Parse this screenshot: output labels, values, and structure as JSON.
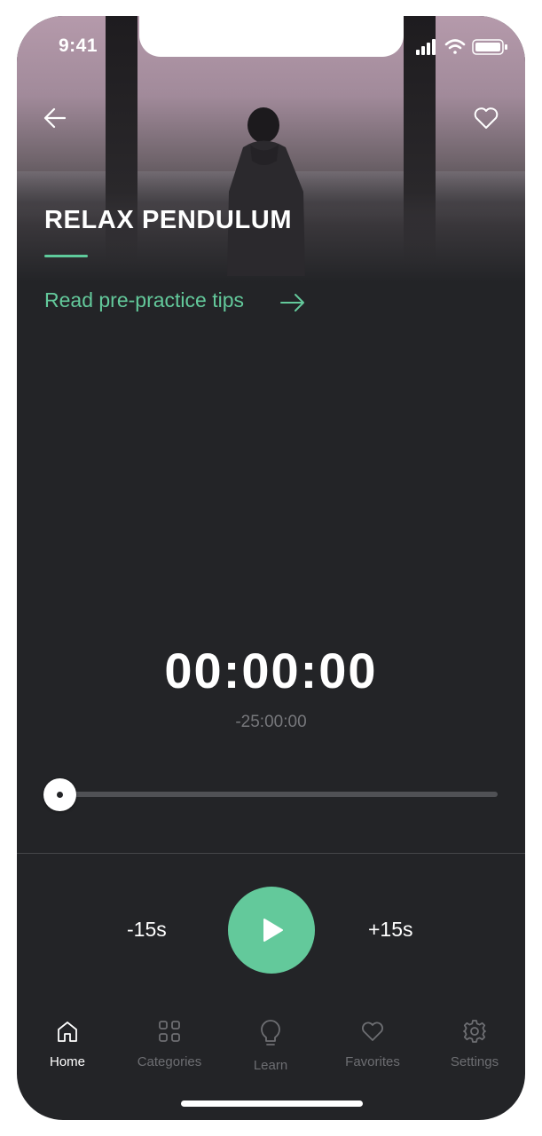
{
  "status_bar": {
    "time": "9:41"
  },
  "header": {
    "title": "RELAX PENDULUM",
    "tips_link": "Read pre-practice tips"
  },
  "player": {
    "elapsed": "00:00:00",
    "remaining": "-25:00:00",
    "progress": 0,
    "skip_back_label": "-15s",
    "skip_forward_label": "+15s"
  },
  "tabs": [
    {
      "label": "Home",
      "icon": "home-icon",
      "active": true
    },
    {
      "label": "Categories",
      "icon": "grid-icon",
      "active": false
    },
    {
      "label": "Learn",
      "icon": "lightbulb-icon",
      "active": false
    },
    {
      "label": "Favorites",
      "icon": "heart-icon",
      "active": false
    },
    {
      "label": "Settings",
      "icon": "gear-icon",
      "active": false
    }
  ],
  "colors": {
    "accent": "#63c99b",
    "background": "#232427",
    "active_tab": "#ffffff",
    "inactive_tab": "#6d6e72"
  }
}
